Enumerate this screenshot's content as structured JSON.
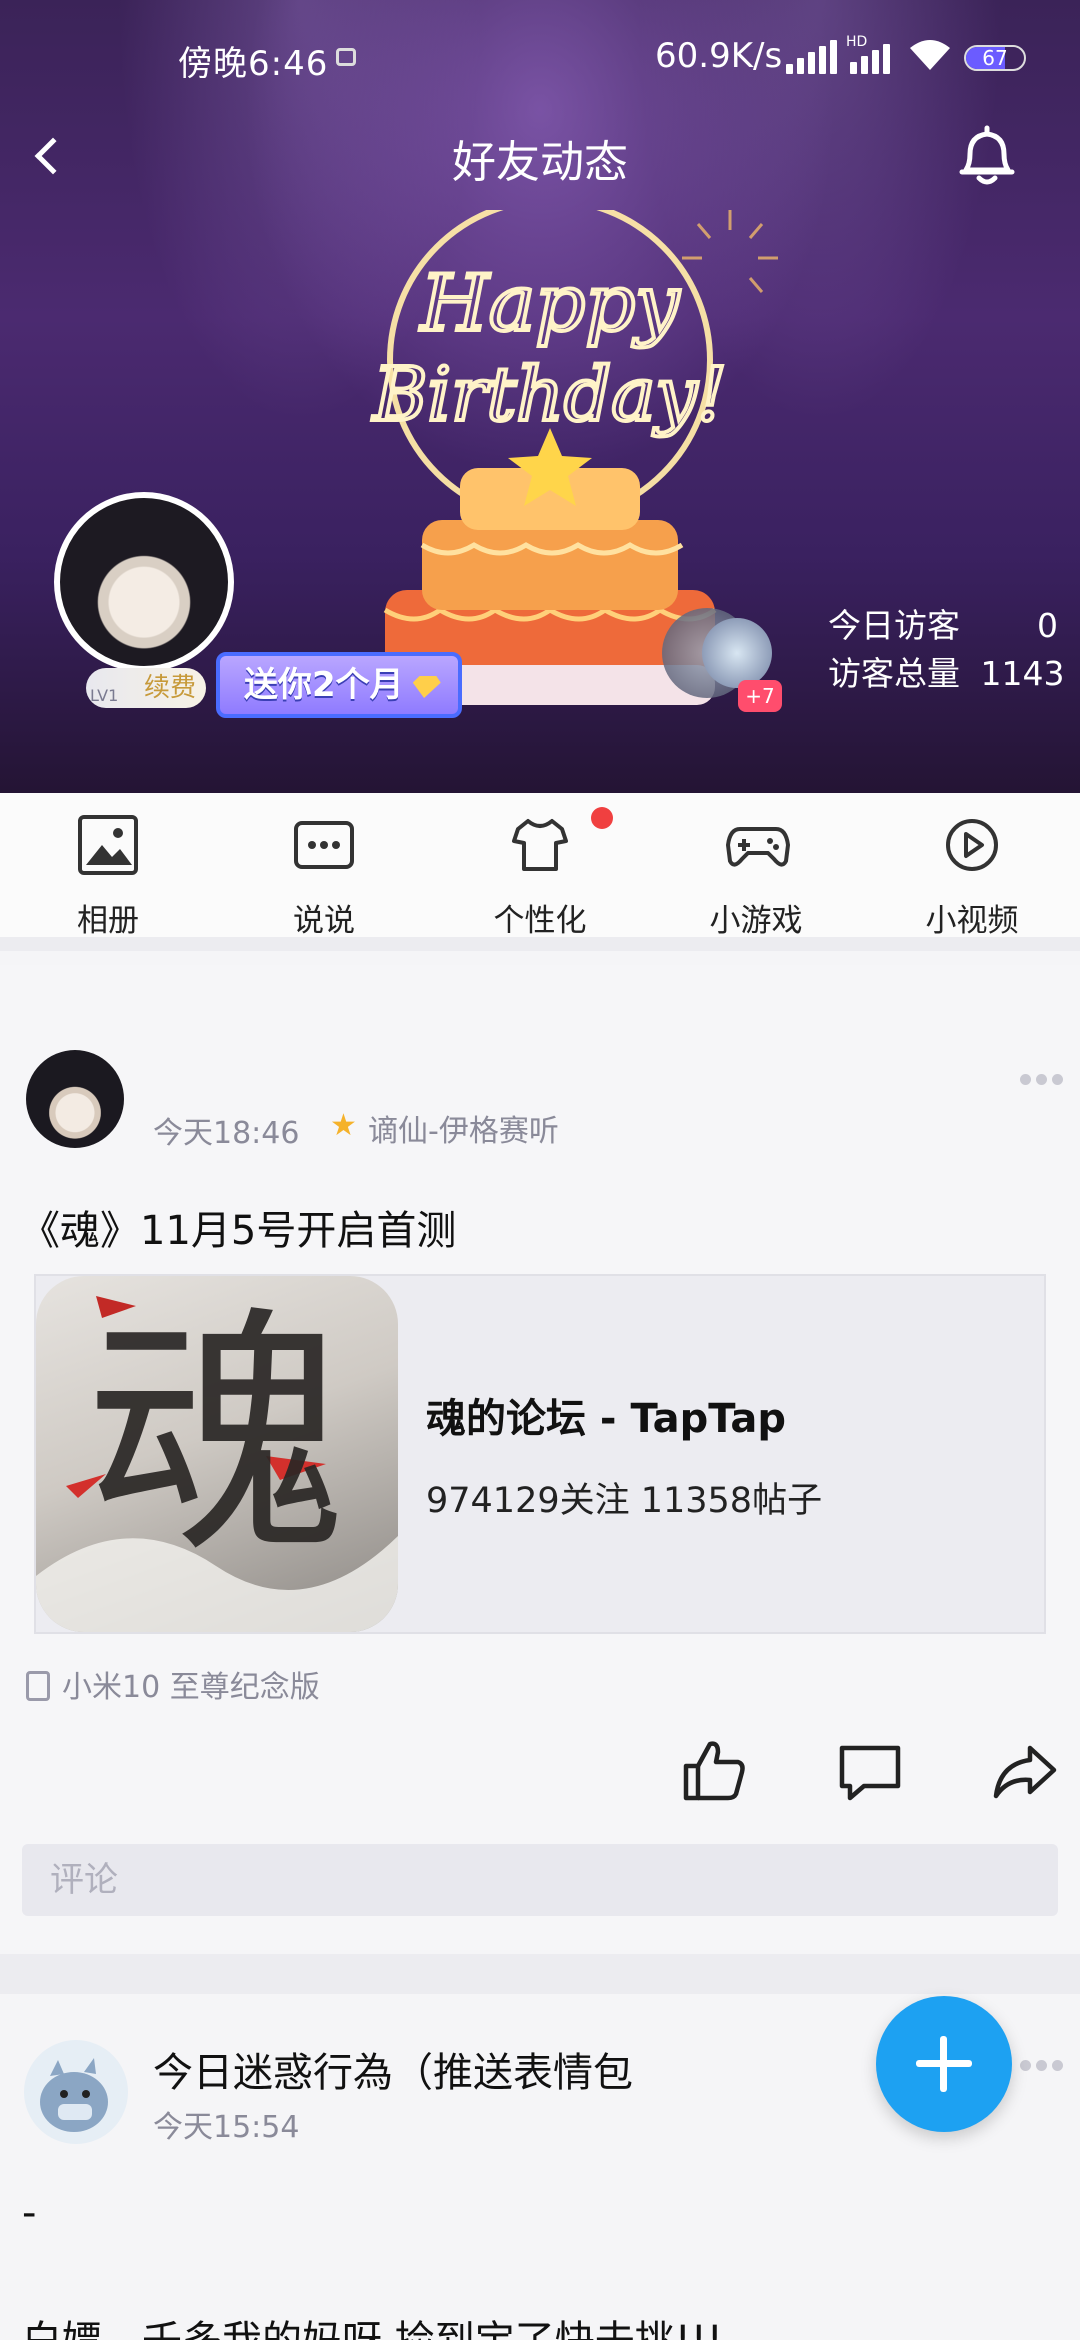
{
  "status_bar": {
    "time": "傍晚6:46",
    "net_speed": "60.9K/s",
    "network_badge": "HD",
    "battery": "67",
    "battery_level": 0.67
  },
  "header": {
    "title": "好友动态",
    "back_icon": "chevron-left-icon",
    "bell_icon": "bell-icon"
  },
  "hero": {
    "banner_text_line1": "Happy",
    "banner_text_line2": "Birthday!",
    "renew_label": "续费",
    "level_badge": "LV1",
    "gift_label": "送你2个月",
    "friends_more_badge": "+7",
    "visitors_today_label": "今日访客",
    "visitors_today_value": "0",
    "visitors_total_label": "访客总量",
    "visitors_total_value": "1143"
  },
  "quick_actions": [
    {
      "label": "相册",
      "icon": "photo-album-icon"
    },
    {
      "label": "说说",
      "icon": "chat-bubble-icon"
    },
    {
      "label": "个性化",
      "icon": "tshirt-icon"
    },
    {
      "label": "小游戏",
      "icon": "gamepad-icon"
    },
    {
      "label": "小视频",
      "icon": "play-circle-icon"
    }
  ],
  "posts": [
    {
      "time": "今天18:46",
      "tag": "谪仙-伊格赛听",
      "text": "《魂》11月5号开启首测",
      "share": {
        "title": "魂的论坛 - TapTap",
        "subtitle": "974129关注 11358帖子",
        "image_char": "魂"
      },
      "device": "小米10 至尊纪念版",
      "comment_placeholder": "评论"
    },
    {
      "name": "今日迷惑行為（推送表情包",
      "time": "今天15:54",
      "text": "-",
      "text2": "白嫖，壬多我的妈呀 捡到宝了快去挑!!!"
    }
  ],
  "colors": {
    "accent": "#1da1f2",
    "notify_dot": "#f04040",
    "hero_bg": "#3b2358"
  }
}
